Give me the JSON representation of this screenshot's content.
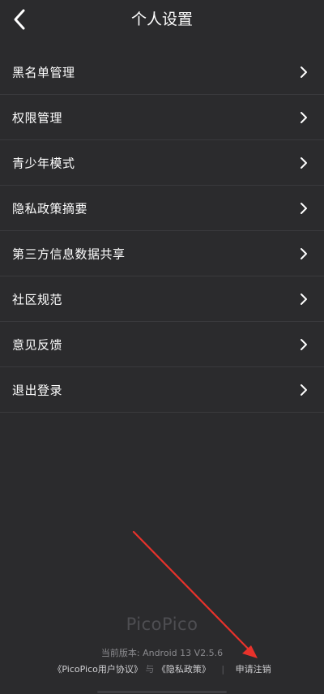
{
  "header": {
    "title": "个人设置",
    "back_icon": "chevron-left-icon"
  },
  "menu": {
    "items": [
      {
        "label": "黑名单管理"
      },
      {
        "label": "权限管理"
      },
      {
        "label": "青少年模式"
      },
      {
        "label": "隐私政策摘要"
      },
      {
        "label": "第三方信息数据共享"
      },
      {
        "label": "社区规范"
      },
      {
        "label": "意见反馈"
      },
      {
        "label": "退出登录"
      }
    ]
  },
  "footer": {
    "logo_text": "PicoPico",
    "version_text": "当前版本: Android 13   V2.5.6",
    "user_agreement": "《PicoPico用户协议》",
    "conjunction": "与",
    "privacy_policy": "《隐私政策》",
    "separator": "|",
    "cancel_account": "申请注销"
  },
  "colors": {
    "background": "#2b2b2d",
    "divider": "#3a3a3d",
    "annotation_arrow": "#e8322b"
  }
}
